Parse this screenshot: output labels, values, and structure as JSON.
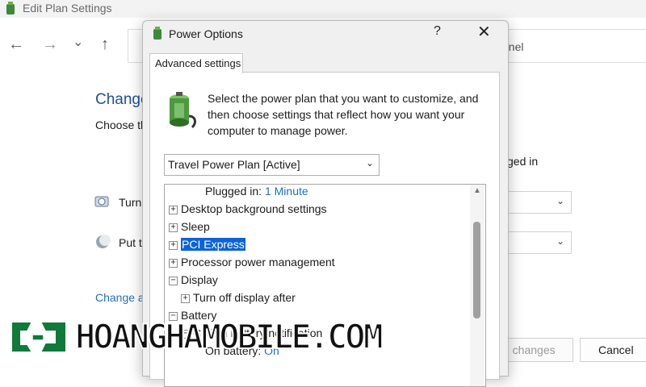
{
  "background_window": {
    "title": "Edit Plan Settings",
    "nav": {
      "back": "←",
      "forward": "→",
      "recent": "⌄",
      "up": "↑"
    },
    "address_fragment": "anel",
    "heading_fragment": "Change",
    "choose_fragment": "Choose th",
    "plugged_in_fragment": "ged in",
    "turn_fragment": "Turn",
    "put_fragment": "Put t",
    "change_link_fragment": "Change a",
    "select_chevron": "⌄",
    "save_fragment": "e changes",
    "cancel_label": "Cancel"
  },
  "dialog": {
    "title": "Power Options",
    "help": "?",
    "close": "✕",
    "tab_label": "Advanced settings",
    "intro": "Select the power plan that you want to customize, and then choose settings that reflect how you want your computer to manage power.",
    "plan_select": {
      "value": "Travel Power Plan [Active]",
      "chevron": "⌄"
    },
    "tree": {
      "plugged_label": "Plugged in:",
      "plugged_value": "1 Minute",
      "items": {
        "desktop": "Desktop background settings",
        "sleep": "Sleep",
        "pci": "PCI Express",
        "processor": "Processor power management",
        "display": "Display",
        "turn_off": "Turn off display after",
        "battery": "Battery",
        "critical": "Critical battery notification"
      },
      "on_battery_label": "On battery:",
      "on_battery_value": "On",
      "expand_glyph": "+",
      "collapse_glyph": "−",
      "scroll_up": "▲"
    }
  },
  "watermark": {
    "text": "HOANGHAMOBILE.COM",
    "accent": "#0f7a3a"
  },
  "colors": {
    "accent_blue": "#1e6fc2",
    "selection": "#0b63d6",
    "heading_blue": "#1e4fa3"
  }
}
